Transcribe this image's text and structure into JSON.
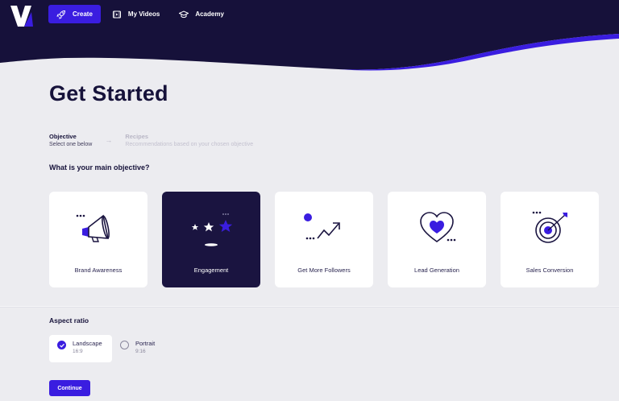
{
  "nav": {
    "items": [
      {
        "label": "Create",
        "icon": "rocket-icon",
        "active": true
      },
      {
        "label": "My Videos",
        "icon": "video-icon",
        "active": false
      },
      {
        "label": "Academy",
        "icon": "graduation-cap-icon",
        "active": false
      }
    ]
  },
  "page": {
    "title": "Get Started"
  },
  "steps": [
    {
      "title": "Objective",
      "desc": "Select one below"
    },
    {
      "title": "Recipes",
      "desc": "Recommendations based on your chosen objective"
    }
  ],
  "question": "What is your main objective?",
  "objectives": [
    {
      "label": "Brand Awareness",
      "icon": "megaphone-icon",
      "selected": false
    },
    {
      "label": "Engagement",
      "icon": "stars-icon",
      "selected": true
    },
    {
      "label": "Get More Followers",
      "icon": "growth-arrow-icon",
      "selected": false
    },
    {
      "label": "Lead Generation",
      "icon": "heart-icon",
      "selected": false
    },
    {
      "label": "Sales Conversion",
      "icon": "target-icon",
      "selected": false
    }
  ],
  "aspect": {
    "title": "Aspect ratio",
    "options": [
      {
        "label": "Landscape",
        "ratio": "16:9",
        "selected": true
      },
      {
        "label": "Portrait",
        "ratio": "9:16",
        "selected": false
      }
    ]
  },
  "continue_label": "Continue",
  "colors": {
    "navy": "#1a1440",
    "accent": "#3a1de0",
    "background": "#ececf0"
  }
}
